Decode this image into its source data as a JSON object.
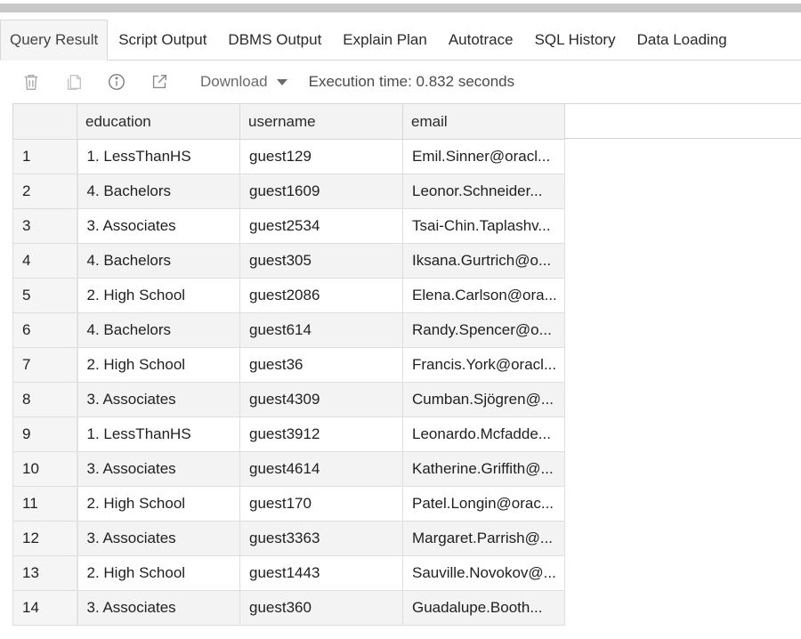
{
  "tabs": [
    {
      "label": "Query Result",
      "active": true
    },
    {
      "label": "Script Output"
    },
    {
      "label": "DBMS Output"
    },
    {
      "label": "Explain Plan"
    },
    {
      "label": "Autotrace"
    },
    {
      "label": "SQL History"
    },
    {
      "label": "Data Loading"
    }
  ],
  "toolbar": {
    "icons": [
      "trash-icon",
      "copy-icon",
      "info-icon",
      "open-external-icon"
    ],
    "download_label": "Download",
    "execution_time": "Execution time: 0.832 seconds"
  },
  "table": {
    "columns": [
      "education",
      "username",
      "email"
    ],
    "rows": [
      {
        "num": "1",
        "education": "1. LessThanHS",
        "username": "guest129",
        "email": "Emil.Sinner@oracl..."
      },
      {
        "num": "2",
        "education": "4. Bachelors",
        "username": "guest1609",
        "email": "Leonor.Schneider..."
      },
      {
        "num": "3",
        "education": "3. Associates",
        "username": "guest2534",
        "email": "Tsai-Chin.Taplashv..."
      },
      {
        "num": "4",
        "education": "4. Bachelors",
        "username": "guest305",
        "email": "Iksana.Gurtrich@o..."
      },
      {
        "num": "5",
        "education": "2. High School",
        "username": "guest2086",
        "email": "Elena.Carlson@ora..."
      },
      {
        "num": "6",
        "education": "4. Bachelors",
        "username": "guest614",
        "email": "Randy.Spencer@o..."
      },
      {
        "num": "7",
        "education": "2. High School",
        "username": "guest36",
        "email": "Francis.York@oracl..."
      },
      {
        "num": "8",
        "education": "3. Associates",
        "username": "guest4309",
        "email": "Cumban.Sjögren@..."
      },
      {
        "num": "9",
        "education": "1. LessThanHS",
        "username": "guest3912",
        "email": "Leonardo.Mcfadde..."
      },
      {
        "num": "10",
        "education": "3. Associates",
        "username": "guest4614",
        "email": "Katherine.Griffith@..."
      },
      {
        "num": "11",
        "education": "2. High School",
        "username": "guest170",
        "email": "Patel.Longin@orac..."
      },
      {
        "num": "12",
        "education": "3. Associates",
        "username": "guest3363",
        "email": "Margaret.Parrish@..."
      },
      {
        "num": "13",
        "education": "2. High School",
        "username": "guest1443",
        "email": "Sauville.Novokov@..."
      },
      {
        "num": "14",
        "education": "3. Associates",
        "username": "guest360",
        "email": "Guadalupe.Booth..."
      }
    ]
  }
}
